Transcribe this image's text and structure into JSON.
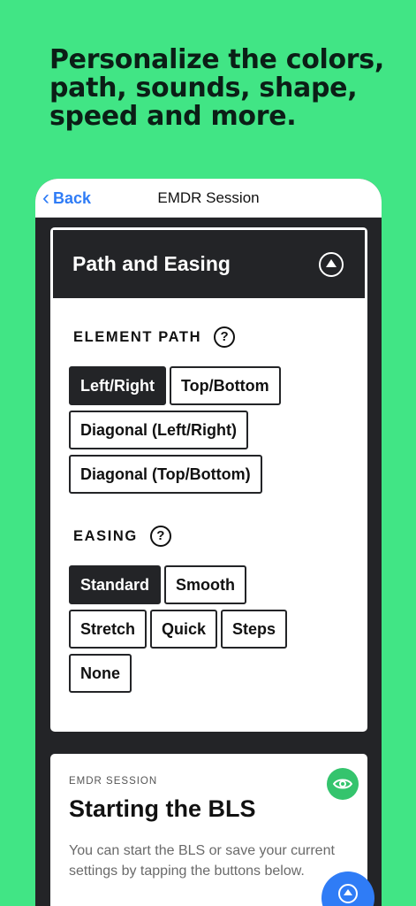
{
  "promo": {
    "headline": "Personalize the colors, path, sounds, shape, speed and more."
  },
  "navbar": {
    "back_label": "Back",
    "title": "EMDR Session"
  },
  "path_card": {
    "title": "Path and Easing",
    "element_path": {
      "label": "ELEMENT PATH",
      "options": [
        "Left/Right",
        "Top/Bottom",
        "Diagonal (Left/Right)",
        "Diagonal (Top/Bottom)"
      ],
      "selected": "Left/Right"
    },
    "easing": {
      "label": "EASING",
      "options": [
        "Standard",
        "Smooth",
        "Stretch",
        "Quick",
        "Steps",
        "None"
      ],
      "selected": "Standard"
    }
  },
  "session_card": {
    "kicker": "EMDR SESSION",
    "title": "Starting the BLS",
    "body": "You can start the BLS or save your current settings by tapping the buttons below."
  },
  "colors": {
    "background": "#41e585",
    "dark": "#232427",
    "accent_blue": "#2f7cf6",
    "eye_green": "#34c46d"
  },
  "icons": {
    "back": "chevron-left-icon",
    "collapse": "chevron-up-circle-icon",
    "help": "question-circle-icon",
    "preview": "eye-icon",
    "fab": "chevron-up-circle-icon"
  }
}
